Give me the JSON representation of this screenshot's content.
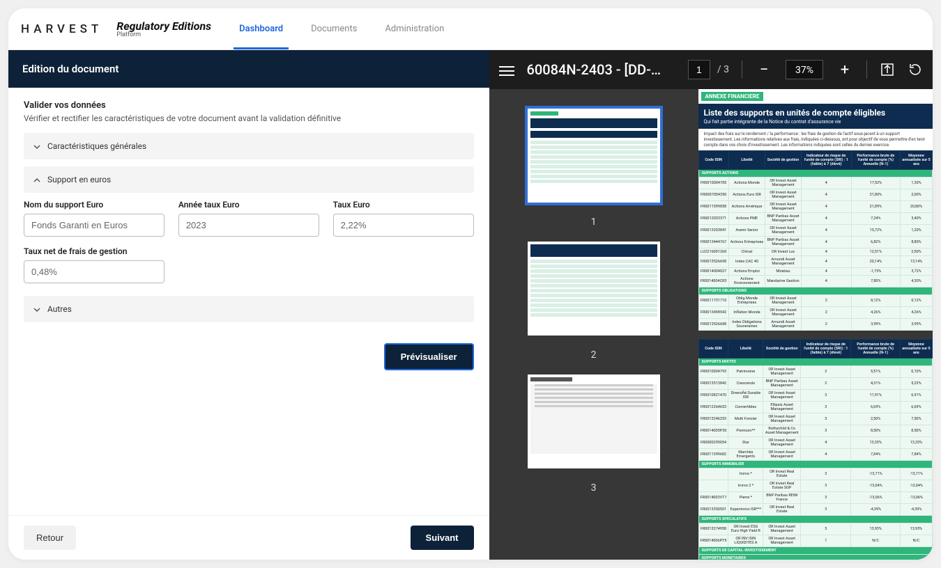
{
  "header": {
    "logo": "HARVEST",
    "product": "Regulatory Editions",
    "product_sub": "Platform",
    "tabs": [
      {
        "label": "Dashboard",
        "active": true
      },
      {
        "label": "Documents",
        "active": false
      },
      {
        "label": "Administration",
        "active": false
      }
    ]
  },
  "left": {
    "banner": "Edition du document",
    "validate_title": "Valider vos données",
    "validate_sub": "Vérifier et rectifier les caractéristiques de votre document avant la validation définitive",
    "accordions": {
      "general": "Caractéristiques générales",
      "euro": "Support en euros",
      "other": "Autres"
    },
    "fields": {
      "name_label": "Nom du support Euro",
      "name_value": "Fonds Garanti en Euros",
      "year_label": "Année taux Euro",
      "year_value": "2023",
      "rate_label": "Taux Euro",
      "rate_value": "2,22%",
      "net_label": "Taux net de frais de gestion",
      "net_value": "0,48%"
    },
    "buttons": {
      "preview": "Prévisualiser",
      "back": "Retour",
      "next": "Suivant"
    }
  },
  "viewer": {
    "title": "60084N-2403 - [DD-…",
    "page_current": "1",
    "page_total": "/  3",
    "zoom": "37%",
    "thumbs": [
      "1",
      "2",
      "3"
    ]
  },
  "document": {
    "tag": "ANNEXE FINANCIERE",
    "title": "Liste des supports en unités de compte éligibles",
    "subtitle": "Qui fait partie intégrante de la Notice du contrat d'assurance vie",
    "note": "Impact des frais sur le rendement / la performance : les frais de gestion de l'actif sous-jacent à un support investissement. Les informations relatives aux frais, indiquées ci-dessous, ont pour objectif de vous permettre d'en tenir compte dans vos choix d'investissement. Les informations indiquées sont celles du dernier exercice.",
    "columns": [
      "Code ISIN",
      "Libellé",
      "Société de gestion",
      "Indicateur de risque de l'unité de compte (SRI) : 1 (faible) à 7 (élevé)",
      "Performance brute de l'unité de compte (%) Annuelle (N-1)",
      "Moyenne annualisée sur 5 ans"
    ],
    "sections": [
      {
        "title": "SUPPORTS ACTIONS",
        "rows": [
          [
            "FR0010004785",
            "Actions Monde",
            "OR Invest Asset Management",
            "4",
            "17,52%",
            "1,30%"
          ],
          [
            "FR0007054350",
            "Actions Euro ISR",
            "OR Invest Asset Management",
            "4",
            "21,80%",
            "2,00%"
          ],
          [
            "FR0011599858",
            "Actions Amérique",
            "OR Invest Asset Management",
            "4",
            "21,89%",
            "20,80%"
          ],
          [
            "FR0012033371",
            "Actions PME",
            "BNP Paribas Asset Management",
            "4",
            "7,24%",
            "3,40%"
          ],
          [
            "FR0013203841",
            "Avenir Senior",
            "OR Invest Asset Management",
            "4",
            "15,72%",
            "1,20%"
          ],
          [
            "FR0013444767",
            "Actions Entreprises",
            "BNP Paribas Asset Management",
            "4",
            "6,82%",
            "8,80%"
          ],
          [
            "LU2216001268",
            "Climat",
            "OR Invest Lux",
            "4",
            "12,51%",
            "2,50%"
          ],
          [
            "FR0013526698",
            "Index CAC 40",
            "Amundi Asset Management",
            "4",
            "20,14%",
            "13,14%"
          ],
          [
            "FR0014004027",
            "Actions Emploi",
            "Mirabau",
            "4",
            "-1,73%",
            "3,72%"
          ],
          [
            "FR0014004CR3",
            "Actions Environnement",
            "Mandarine Gestion",
            "4",
            "7,80%",
            "4,30%"
          ]
        ]
      },
      {
        "title": "SUPPORTS OBLIGATIONS",
        "rows": [
          [
            "FR0011731710",
            "Oblig Monde Entreprises",
            "OR Invest Asset Management",
            "2",
            "8,12%",
            "0,12%"
          ],
          [
            "FR0013498542",
            "Inflation Monde",
            "OR Invest Asset Management",
            "2",
            "4,26%",
            "4,26%"
          ],
          [
            "FR0013526688",
            "Index Obligations Souveraines",
            "Amundi Asset Management",
            "2",
            "3,99%",
            "3,99%"
          ]
        ]
      },
      {
        "title": "SUPPORTS MIXTES",
        "rows": [
          [
            "FR0010004793",
            "Patrimoine",
            "OR Invest Asset Management",
            "2",
            "5,51%",
            "0,10%"
          ],
          [
            "FR0013513842",
            "Crescendo",
            "BNP Paribas Asset Management",
            "2",
            "4,31%",
            "5,23%"
          ],
          [
            "FR0010821470",
            "Diversifié Durable ISR",
            "OR Invest Asset Management",
            "3",
            "11,91%",
            "6,91%"
          ],
          [
            "FR0012264653",
            "Convertibles",
            "Ellipsis Asset Management",
            "3",
            "6,69%",
            "6,69%"
          ],
          [
            "FR0013246253",
            "Multi Foncier",
            "OR Invest Asset Management",
            "3",
            "2,50%",
            "7,50%"
          ],
          [
            "FR0014005P30",
            "Premium**",
            "Rothschild & Co Asset Management",
            "3",
            "8,50%",
            "8,50%"
          ],
          [
            "FR0000295054",
            "Star",
            "OR Invest Asset Management",
            "4",
            "13,33%",
            "13,33%"
          ],
          [
            "FR0011399682",
            "Marchés Emergents",
            "OR Invest Asset Management",
            "4",
            "7,84%",
            "7,84%"
          ]
        ]
      },
      {
        "title": "SUPPORTS IMMOBILIER",
        "rows": [
          [
            "",
            "Immo *",
            "OR Invest Real Estate",
            "3",
            "-13,71%",
            "-13,71%"
          ],
          [
            "",
            "Immo 2 *",
            "OR Invest Real Estate SGP",
            "3",
            "-13,04%",
            "-12,04%"
          ],
          [
            "FR0014003VT7",
            "Pierre *",
            "BNP Paribas REIM France",
            "3",
            "-13,06%",
            "-13,06%"
          ],
          [
            "FR0013350501",
            "Experimmo ISR***",
            "OR Invest Real Estate",
            "3",
            "-4,39%",
            "-4,39%"
          ]
        ]
      },
      {
        "title": "SUPPORTS SPECULATIFS",
        "rows": [
          [
            "FR0013274958",
            "OR Invest ESG Euro High Yield R",
            "OR Invest Asset Management",
            "3",
            "13,93%",
            "13,93%"
          ],
          [
            "FR0014006PY5",
            "OR INV ISIN LIQUIDITES A",
            "OR Invest Asset Management",
            "1",
            "N/C",
            "N/C"
          ]
        ]
      },
      {
        "title": "SUPPORTS DE CAPITAL-INVESTISSEMENT",
        "rows": []
      },
      {
        "title": "SUPPORTS MONETAIRES",
        "rows": []
      }
    ]
  }
}
